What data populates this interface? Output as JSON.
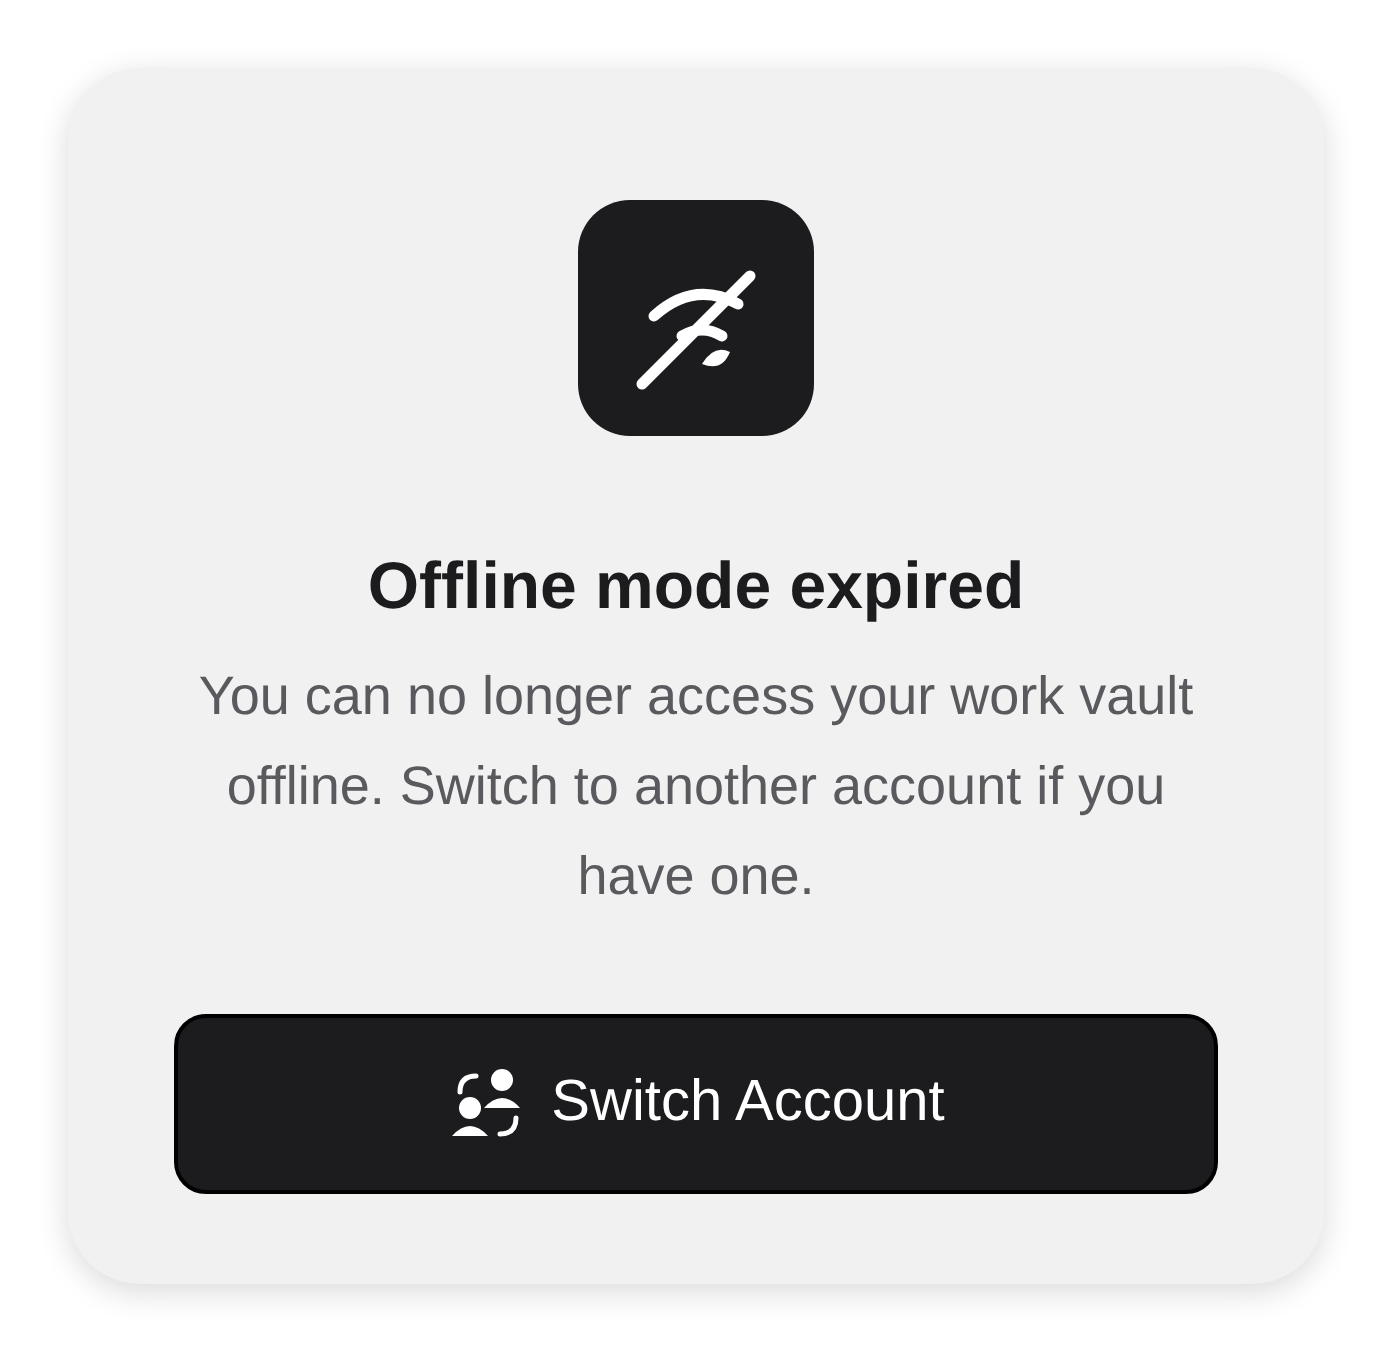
{
  "dialog": {
    "title": "Offline mode expired",
    "message": "You can no longer access your work vault offline. Switch to another account if you have one.",
    "button": "Switch Account"
  }
}
